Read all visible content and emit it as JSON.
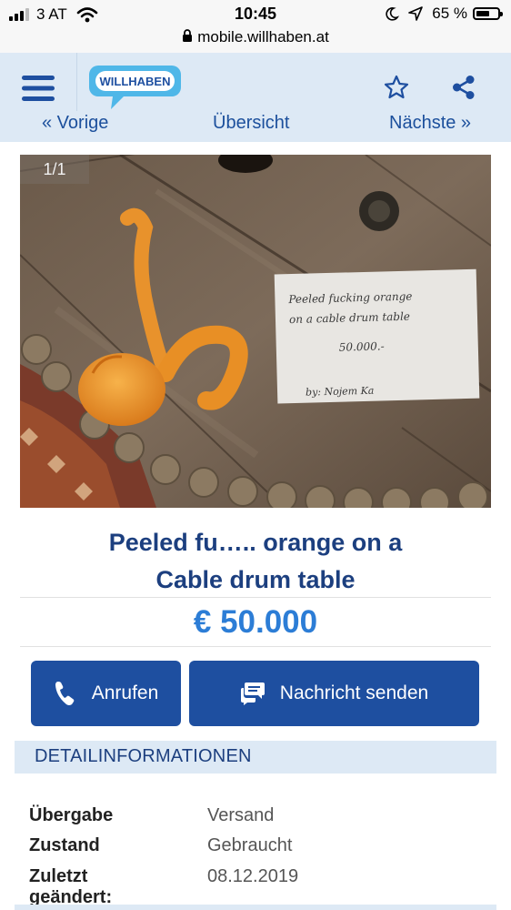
{
  "status_bar": {
    "carrier": "3 AT",
    "time": "10:45",
    "url": "mobile.willhaben.at",
    "battery": "65 %",
    "battery_level": 0.65,
    "icons": [
      "signal-bars-icon",
      "wifi-icon",
      "lock-icon",
      "moon-icon",
      "location-arrow-icon",
      "battery-icon"
    ]
  },
  "header": {
    "logo_text": "WILLHABEN",
    "menu_icon": "hamburger-menu-icon",
    "favorite_icon": "star-outline-icon",
    "share_icon": "share-icon"
  },
  "pager": {
    "prev": "« Vorige",
    "overview": "Übersicht",
    "next": "Nächste »"
  },
  "listing": {
    "image_counter": "1/1",
    "title_line1": "Peeled fu….. orange on a",
    "title_line2": "Cable drum table",
    "price": "€ 50.000",
    "photo_note": {
      "line1": "Peeled fucking orange",
      "line2": "on a cable drum table",
      "line3": "50.000.-",
      "line4": "by: Nojem Ka"
    }
  },
  "actions": {
    "call_label": "Anrufen",
    "message_label": "Nachricht senden"
  },
  "details": {
    "section_title": "DETAILINFORMATIONEN",
    "rows": [
      {
        "key": "Übergabe",
        "value": "Versand"
      },
      {
        "key": "Zustand",
        "value": "Gebraucht"
      },
      {
        "key": "Zuletzt geändert:",
        "value": "08.12.2019"
      }
    ]
  },
  "colors": {
    "brand_blue": "#1e4fa0",
    "price_blue": "#2c7dd6",
    "header_bg": "#dde9f5",
    "title_blue": "#1c3f7f"
  }
}
